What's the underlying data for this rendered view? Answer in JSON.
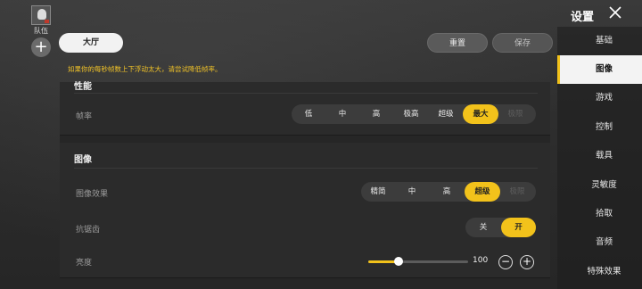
{
  "team": {
    "label": "队伍",
    "add_symbol": "+"
  },
  "topbar": {
    "hall_label": "大厅",
    "reset_label": "重置",
    "save_label": "保存",
    "warning": "如果你的每秒帧数上下浮动太大，请尝试降低帧率。"
  },
  "performance": {
    "title": "性能",
    "framerate": {
      "label": "帧率",
      "options": [
        "低",
        "中",
        "高",
        "极高",
        "超级",
        "最大",
        "极限"
      ],
      "selected": "最大"
    }
  },
  "graphics": {
    "title": "图像",
    "quality": {
      "label": "图像效果",
      "options": [
        "精简",
        "中",
        "高",
        "超级",
        "极限"
      ],
      "selected": "超级"
    },
    "antialias": {
      "label": "抗锯齿",
      "options": [
        "关",
        "开"
      ],
      "selected": "开"
    },
    "brightness": {
      "label": "亮度",
      "value": "100",
      "level": 0.3,
      "minus": "−",
      "plus": "+"
    }
  },
  "settings": {
    "title": "设置",
    "nav": [
      "基础",
      "图像",
      "游戏",
      "控制",
      "载具",
      "灵敏度",
      "拾取",
      "音频",
      "特殊效果"
    ],
    "active": "图像"
  },
  "colors": {
    "accent": "#f2c21b",
    "warning": "#f0c228"
  }
}
